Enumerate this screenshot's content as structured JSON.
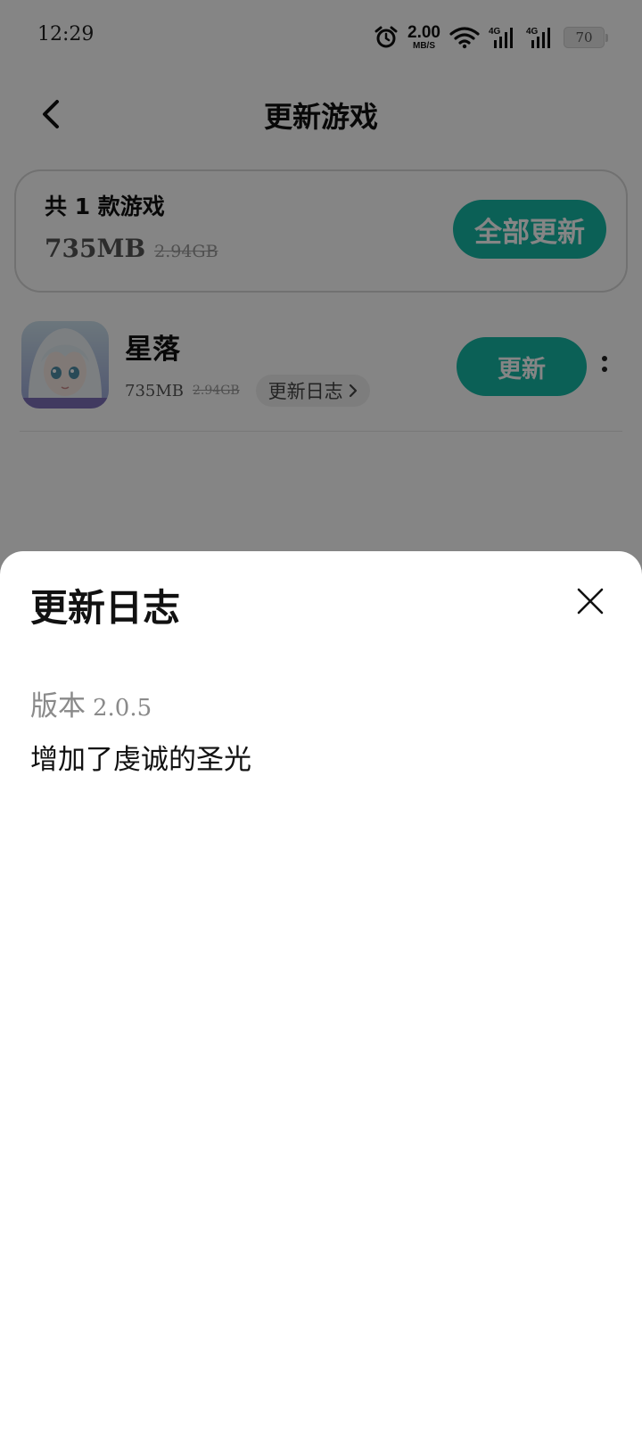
{
  "status_bar": {
    "time": "12:29",
    "net_speed": "2.00",
    "net_speed_unit": "MB/S",
    "signal_label_1": "4G",
    "signal_label_2": "4G",
    "battery": "70",
    "icons": [
      "alarm-icon",
      "wifi-icon",
      "signal-icon",
      "signal-icon",
      "battery-icon"
    ]
  },
  "header": {
    "title": "更新游戏",
    "back_icon": "chevron-left-icon"
  },
  "summary": {
    "count_text": "共 1 款游戏",
    "new_size": "735MB",
    "old_size": "2.94GB",
    "update_all_label": "全部更新"
  },
  "games": [
    {
      "name": "星落",
      "new_size": "735MB",
      "old_size": "2.94GB",
      "changelog_label": "更新日志",
      "update_label": "更新",
      "more_icon": "more-vertical-icon"
    }
  ],
  "sheet": {
    "title": "更新日志",
    "close_icon": "close-icon",
    "version_label": "版本",
    "version": "2.0.5",
    "changelog": "增加了虔诚的圣光"
  },
  "colors": {
    "accent": "#16b8a6",
    "scrim": "rgba(0,0,0,0.48)",
    "text": "#111111",
    "muted": "#8a8a8a"
  }
}
